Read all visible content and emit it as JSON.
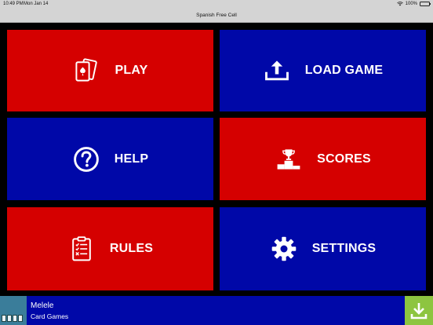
{
  "status": {
    "time": "10:49 PM",
    "date": "Mon Jan 14",
    "battery": "100%"
  },
  "app": {
    "title": "Spanish Free Cell"
  },
  "menu": {
    "play": "PLAY",
    "load_game": "LOAD GAME",
    "help": "HELP",
    "scores": "SCORES",
    "rules": "RULES",
    "settings": "SETTINGS"
  },
  "ad": {
    "title": "Melele",
    "subtitle": "Card Games"
  },
  "colors": {
    "red": "#d50000",
    "blue": "#0008a8",
    "download": "#8dc540"
  }
}
